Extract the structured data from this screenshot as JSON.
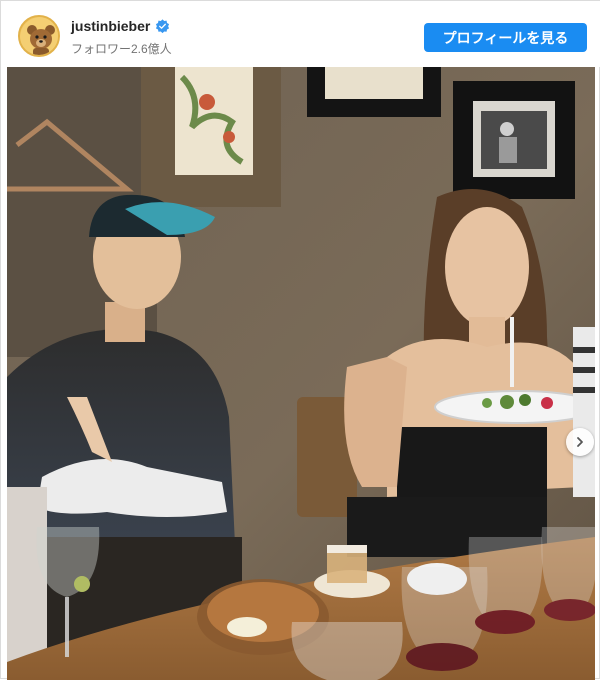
{
  "post": {
    "username": "justinbieber",
    "verified_icon": "verified-badge-icon",
    "followers_text": "フォロワー2.6億人",
    "profile_button_label": "プロフィールを見る",
    "avatar_icon": "teddy-bear-avatar",
    "carousel_icon": "chevron-right-icon"
  },
  "colors": {
    "button": "#1a8cf2",
    "verified": "#3897f0"
  }
}
